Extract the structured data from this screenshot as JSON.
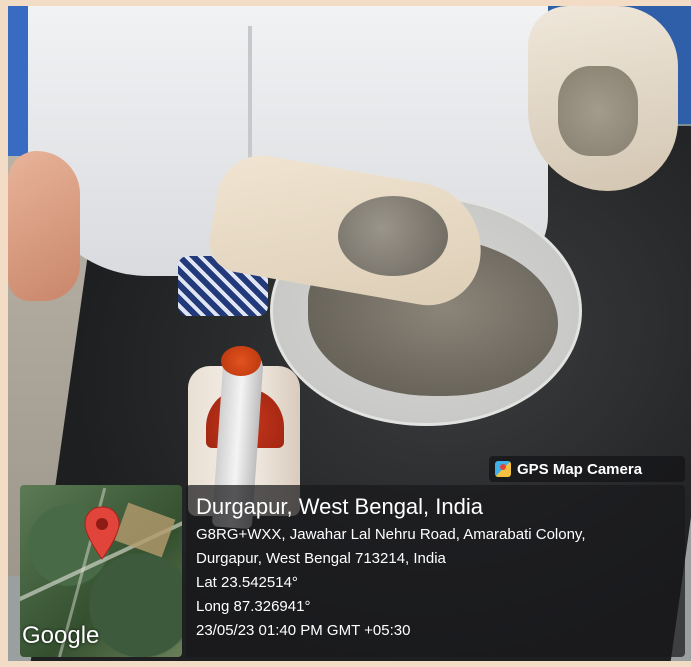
{
  "overlay": {
    "badge_label": "GPS Map Camera",
    "map_attribution": "Google",
    "location_title": "Durgapur, West Bengal, India",
    "address_line1": "G8RG+WXX, Jawahar Lal Nehru Road, Amarabati Colony,",
    "address_line2": "Durgapur, West Bengal 713214, India",
    "latitude": "Lat 23.542514°",
    "longitude": "Long 87.326941°",
    "timestamp": "23/05/23 01:40 PM GMT +05:30"
  },
  "colors": {
    "pin_red": "#e0443a",
    "overlay_bg": "#19191c"
  },
  "icons": {
    "badge": "gps-map-camera-icon",
    "pin": "map-pin-icon"
  }
}
